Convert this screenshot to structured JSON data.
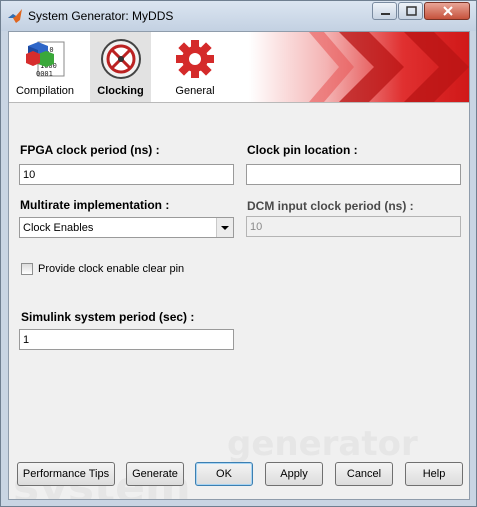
{
  "window": {
    "title": "System Generator: MyDDS"
  },
  "tabs": [
    {
      "label": "Compilation"
    },
    {
      "label": "Clocking"
    },
    {
      "label": "General"
    }
  ],
  "fields": {
    "fpga_clock_period": {
      "label": "FPGA clock period (ns) :",
      "value": "10"
    },
    "clock_pin_location": {
      "label": "Clock pin location :",
      "value": ""
    },
    "multirate": {
      "label": "Multirate implementation :",
      "value": "Clock Enables"
    },
    "dcm_input_clock": {
      "label": "DCM input clock period (ns) :",
      "value": "10"
    },
    "clock_enable_clear": {
      "label": "Provide clock enable clear pin"
    },
    "simulink_period": {
      "label": "Simulink system period (sec) :",
      "value": "1"
    }
  },
  "buttons": {
    "performance_tips": "Performance Tips",
    "generate": "Generate",
    "ok": "OK",
    "apply": "Apply",
    "cancel": "Cancel",
    "help": "Help"
  },
  "watermark": {
    "line1": "generator",
    "line2": "system"
  },
  "icons": [
    "matlab-icon",
    "minimize-icon",
    "maximize-icon",
    "close-icon",
    "compilation-icon",
    "clocking-icon",
    "general-gear-icon",
    "dropdown-arrow-icon"
  ],
  "colors": {
    "brand_red": "#e02020",
    "active_tab": "#e2e2e2",
    "dialog_bg": "#f0f0f0"
  }
}
